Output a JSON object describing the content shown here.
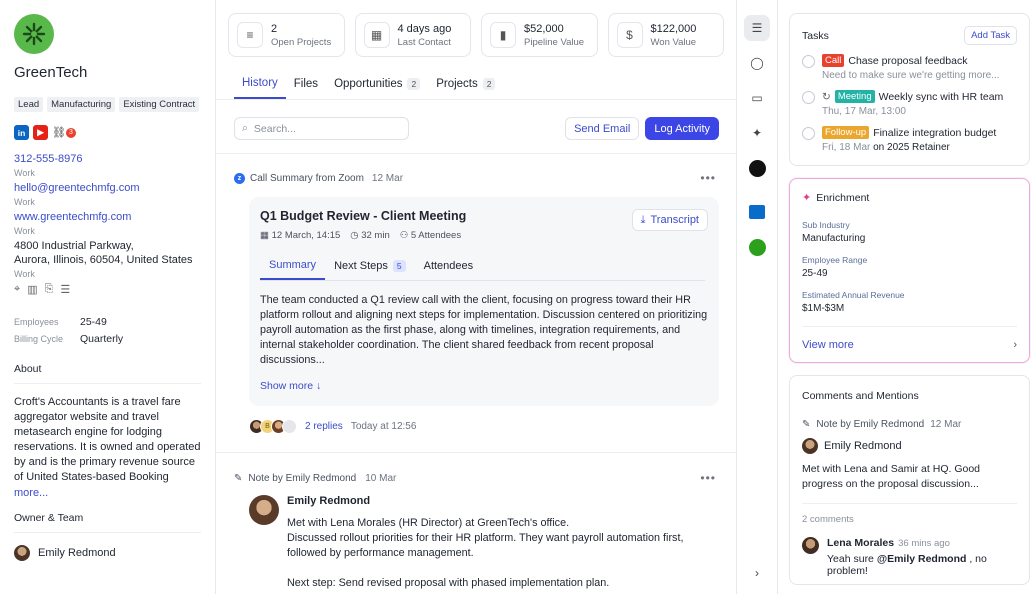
{
  "company": {
    "name": "GreenTech",
    "tags": [
      "Lead",
      "Manufacturing",
      "Existing Contract"
    ],
    "social_badge": "3",
    "phone": "312-555-8976",
    "phone_label": "Work",
    "email": "hello@greentechmfg.com",
    "email_label": "Work",
    "website": "www.greentechmfg.com",
    "website_label": "Work",
    "address_line1": "4800 Industrial Parkway,",
    "address_line2": "Aurora, Illinois, 60504, United States",
    "address_label": "Work",
    "employees_label": "Employees",
    "employees": "25-49",
    "billing_label": "Billing Cycle",
    "billing": "Quarterly",
    "about_title": "About",
    "about": "Croft's Accountants is a travel fare aggregator website and travel metasearch engine for lodging reservations. It is owned and operated by and is the primary revenue source of United States-based Booking",
    "about_more": "more...",
    "owner_title": "Owner & Team",
    "owner": "Emily Redmond"
  },
  "stats": [
    {
      "value": "2",
      "label": "Open Projects",
      "icon": "lines-icon"
    },
    {
      "value": "4 days ago",
      "label": "Last Contact",
      "icon": "calendar-icon"
    },
    {
      "value": "$52,000",
      "label": "Pipeline Value",
      "icon": "bar-chart-icon"
    },
    {
      "value": "$122,000",
      "label": "Won Value",
      "icon": "dollar-icon"
    }
  ],
  "tabs": [
    {
      "label": "History",
      "count": ""
    },
    {
      "label": "Files",
      "count": ""
    },
    {
      "label": "Opportunities",
      "count": "2"
    },
    {
      "label": "Projects",
      "count": "2"
    }
  ],
  "toolbar": {
    "search_placeholder": "Search...",
    "send_email": "Send Email",
    "log_activity": "Log Activity"
  },
  "call": {
    "source": "Call Summary from Zoom",
    "date": "12 Mar",
    "title": "Q1 Budget Review - Client Meeting",
    "meta_date": "12 March, 14:15",
    "meta_duration": "32 min",
    "meta_attendees": "5 Attendees",
    "transcript": "Transcript",
    "subtabs": [
      {
        "label": "Summary",
        "count": ""
      },
      {
        "label": "Next Steps",
        "count": "5"
      },
      {
        "label": "Attendees",
        "count": ""
      }
    ],
    "summary": "The team conducted a Q1 review call with the client, focusing on progress toward their HR platform rollout and aligning next steps for implementation. Discussion centered on prioritizing payroll automation as the first phase, along with timelines, integration requirements, and internal stakeholder coordination. The client shared feedback from recent proposal discussions...",
    "show_more": "Show more",
    "replies_avatar_initial": "B",
    "replies": "2 replies",
    "replies_time": "Today at 12:56"
  },
  "note": {
    "source": "Note by Emily Redmond",
    "date": "10 Mar",
    "author": "Emily Redmond",
    "line1": "Met with Lena Morales (HR Director) at GreenTech's office.",
    "line2": "Discussed rollout priorities for their HR platform. They want payroll automation first, followed by performance management.",
    "line3": "Next step: Send revised proposal with phased implementation plan."
  },
  "tasks": {
    "title": "Tasks",
    "add": "Add Task",
    "items": [
      {
        "tag": "Call",
        "tag_color": "#e8412e",
        "title": "Chase proposal feedback",
        "sub": "Need to make sure we're getting more...",
        "sub_extra": ""
      },
      {
        "tag": "Meeting",
        "tag_color": "#22b3a6",
        "title": "Weekly sync with HR team",
        "sub": "Thu, 17 Mar, 13:00",
        "sub_extra": ""
      },
      {
        "tag": "Follow-up",
        "tag_color": "#eba62e",
        "title": "Finalize integration budget",
        "sub": "Fri, 18 Mar",
        "sub_extra": "on 2025 Retainer"
      }
    ]
  },
  "enrichment": {
    "title": "Enrichment",
    "fields": [
      {
        "label": "Sub Industry",
        "value": "Manufacturing"
      },
      {
        "label": "Employee Range",
        "value": "25-49"
      },
      {
        "label": "Estimated Annual Revenue",
        "value": "$1M-$3M"
      }
    ],
    "view_more": "View more"
  },
  "comments": {
    "title": "Comments and Mentions",
    "source": "Note by Emily Redmond",
    "date": "12 Mar",
    "author": "Emily Redmond",
    "text": "Met with Lena and Samir at HQ. Good progress on the proposal discussion...",
    "count": "2 comments",
    "reply_name": "Lena Morales",
    "reply_time": "36 mins ago",
    "reply_prefix": "Yeah sure",
    "reply_mention": "@Emily Redmond",
    "reply_suffix": ", no problem!"
  }
}
